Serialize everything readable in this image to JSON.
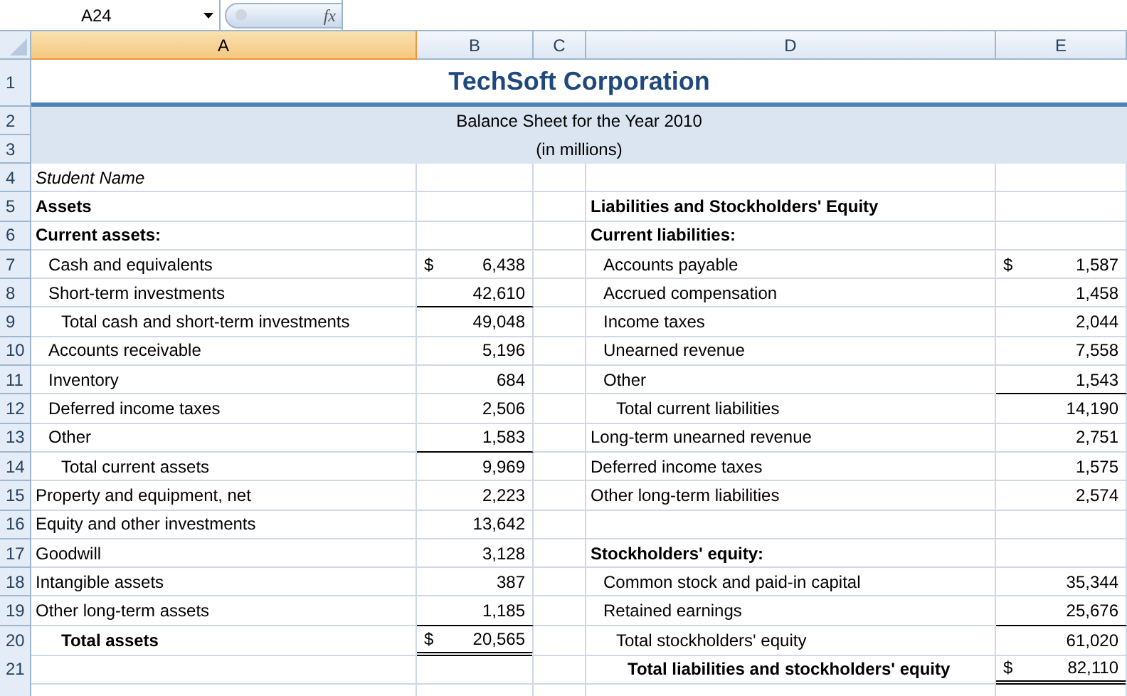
{
  "formula_bar": {
    "name_box": "A24",
    "function_label": "fx"
  },
  "columns": [
    {
      "label": "A",
      "selected": true
    },
    {
      "label": "B",
      "selected": false
    },
    {
      "label": "C",
      "selected": false
    },
    {
      "label": "D",
      "selected": false
    },
    {
      "label": "E",
      "selected": false
    }
  ],
  "rows": [
    {
      "number": "1",
      "kind": "title",
      "text": "TechSoft Corporation"
    },
    {
      "number": "2",
      "kind": "band",
      "text": "Balance Sheet for the Year 2010"
    },
    {
      "number": "3",
      "kind": "band",
      "text": "(in millions)"
    },
    {
      "number": "4",
      "kind": "data",
      "a": {
        "text": "Student Name",
        "kind": "note"
      }
    },
    {
      "number": "5",
      "kind": "data",
      "a": {
        "text": "Assets",
        "kind": "heading"
      },
      "d": {
        "text": "Liabilities and Stockholders' Equity",
        "kind": "heading"
      }
    },
    {
      "number": "6",
      "kind": "data",
      "a": {
        "text": "Current assets:",
        "kind": "heading"
      },
      "d": {
        "text": "Current liabilities:",
        "kind": "heading"
      }
    },
    {
      "number": "7",
      "kind": "data",
      "a": {
        "text": "Cash and equivalents",
        "kind": "item"
      },
      "b": {
        "currency": "$",
        "value": "6,438"
      },
      "d": {
        "text": "Accounts payable",
        "kind": "item"
      },
      "e": {
        "currency": "$",
        "value": "1,587"
      }
    },
    {
      "number": "8",
      "kind": "data",
      "a": {
        "text": "Short-term investments",
        "kind": "item"
      },
      "b": {
        "value": "42,610",
        "single_rule": true
      },
      "d": {
        "text": "Accrued compensation",
        "kind": "item"
      },
      "e": {
        "value": "1,458"
      }
    },
    {
      "number": "9",
      "kind": "data",
      "a": {
        "text": "Total cash and short-term investments",
        "kind": "subtotal"
      },
      "b": {
        "value": "49,048"
      },
      "d": {
        "text": "Income taxes",
        "kind": "item"
      },
      "e": {
        "value": "2,044"
      }
    },
    {
      "number": "10",
      "kind": "data",
      "a": {
        "text": "Accounts receivable",
        "kind": "item"
      },
      "b": {
        "value": "5,196"
      },
      "d": {
        "text": "Unearned revenue",
        "kind": "item"
      },
      "e": {
        "value": "7,558"
      }
    },
    {
      "number": "11",
      "kind": "data",
      "a": {
        "text": "Inventory",
        "kind": "item"
      },
      "b": {
        "value": "684"
      },
      "d": {
        "text": "Other",
        "kind": "item"
      },
      "e": {
        "value": "1,543",
        "single_rule": true
      }
    },
    {
      "number": "12",
      "kind": "data",
      "a": {
        "text": "Deferred income taxes",
        "kind": "item"
      },
      "b": {
        "value": "2,506"
      },
      "d": {
        "text": "Total current liabilities",
        "kind": "subtotal"
      },
      "e": {
        "value": "14,190"
      }
    },
    {
      "number": "13",
      "kind": "data",
      "a": {
        "text": "Other",
        "kind": "item"
      },
      "b": {
        "value": "1,583",
        "single_rule": true
      },
      "d": {
        "text": "Long-term unearned revenue",
        "kind": "plain"
      },
      "e": {
        "value": "2,751"
      }
    },
    {
      "number": "14",
      "kind": "data",
      "a": {
        "text": "Total current assets",
        "kind": "subtotal"
      },
      "b": {
        "value": "9,969"
      },
      "d": {
        "text": "Deferred income taxes",
        "kind": "plain"
      },
      "e": {
        "value": "1,575"
      }
    },
    {
      "number": "15",
      "kind": "data",
      "a": {
        "text": "Property and equipment, net",
        "kind": "plain"
      },
      "b": {
        "value": "2,223"
      },
      "d": {
        "text": "Other long-term liabilities",
        "kind": "plain"
      },
      "e": {
        "value": "2,574"
      }
    },
    {
      "number": "16",
      "kind": "data",
      "a": {
        "text": "Equity and other investments",
        "kind": "plain"
      },
      "b": {
        "value": "13,642"
      }
    },
    {
      "number": "17",
      "kind": "data",
      "a": {
        "text": "Goodwill",
        "kind": "plain"
      },
      "b": {
        "value": "3,128"
      },
      "d": {
        "text": "Stockholders' equity:",
        "kind": "heading"
      }
    },
    {
      "number": "18",
      "kind": "data",
      "a": {
        "text": "Intangible assets",
        "kind": "plain"
      },
      "b": {
        "value": "387"
      },
      "d": {
        "text": "Common stock and paid-in capital",
        "kind": "item"
      },
      "e": {
        "value": "35,344"
      }
    },
    {
      "number": "19",
      "kind": "data",
      "a": {
        "text": "Other long-term assets",
        "kind": "plain"
      },
      "b": {
        "value": "1,185",
        "single_rule": true
      },
      "d": {
        "text": "Retained earnings",
        "kind": "item"
      },
      "e": {
        "value": "25,676",
        "single_rule": true
      }
    },
    {
      "number": "20",
      "kind": "data",
      "a": {
        "text": "Total assets",
        "kind": "total"
      },
      "b": {
        "currency": "$",
        "value": "20,565",
        "double_rule": true
      },
      "d": {
        "text": "Total stockholders' equity",
        "kind": "subtotal"
      },
      "e": {
        "value": "61,020"
      }
    },
    {
      "number": "21",
      "kind": "data",
      "d": {
        "text": "Total liabilities and stockholders' equity",
        "kind": "grand_total"
      },
      "e": {
        "currency": "$",
        "value": "82,110",
        "double_rule": true
      }
    }
  ]
}
